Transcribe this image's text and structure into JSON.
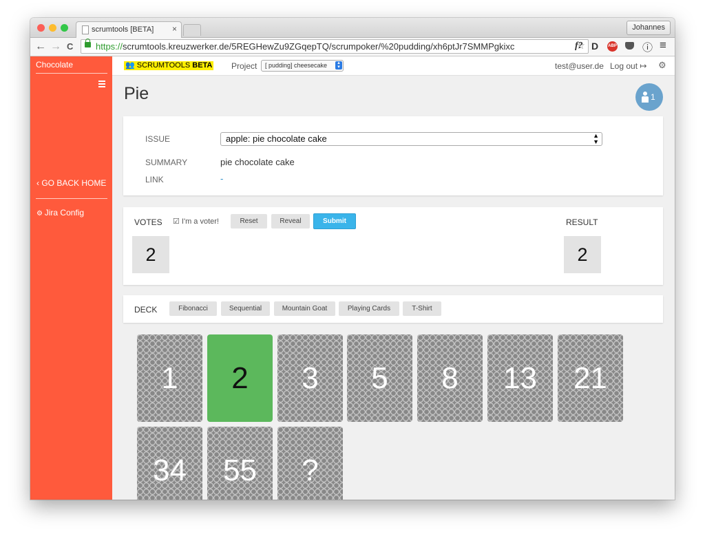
{
  "browser": {
    "tab_title": "scrumtools [BETA]",
    "tab_close": "×",
    "user_button": "Johannes",
    "url_scheme": "https://",
    "url_rest": "scrumtools.kreuzwerker.de/5REGHewZu9ZGqepTQ/scrumpoker/%20pudding/xh6ptJr7SMMPgkixc",
    "traffic_colors": [
      "#fc5f57",
      "#fdbc2e",
      "#33c748"
    ],
    "nav": {
      "back": "←",
      "forward": "→",
      "reload": "C"
    },
    "extensions": [
      "f?",
      "D",
      "ABP",
      "pocket",
      "ⓘ",
      "≡"
    ]
  },
  "sidebar": {
    "title": "Chocolate",
    "go_back_home": "GO BACK HOME",
    "jira_config": "Jira Config",
    "background": "#ff5a3c"
  },
  "topbar": {
    "logo_text": "SCRUMTOOLS",
    "logo_beta": "BETA",
    "project_label": "Project",
    "project_value": "[ pudding] cheesecake",
    "email": "test@user.de",
    "logout": "Log out"
  },
  "page": {
    "title": "Pie",
    "user_count": "1"
  },
  "issue": {
    "issue_label": "ISSUE",
    "issue_value": "apple: pie chocolate cake",
    "summary_label": "SUMMARY",
    "summary_value": "pie chocolate cake",
    "link_label": "LINK",
    "link_value": "-"
  },
  "votes": {
    "votes_label": "VOTES",
    "voter_checkbox": "I'm a voter!",
    "reset": "Reset",
    "reveal": "Reveal",
    "submit": "Submit",
    "vote_value": "2",
    "result_label": "RESULT",
    "result_value": "2"
  },
  "deck": {
    "label": "DECK",
    "options": [
      "Fibonacci",
      "Sequential",
      "Mountain Goat",
      "Playing Cards",
      "T-Shirt"
    ],
    "cards": [
      "1",
      "2",
      "3",
      "5",
      "8",
      "13",
      "21",
      "34",
      "55",
      "?"
    ],
    "selected": "2",
    "selected_color": "#5cb85c"
  }
}
